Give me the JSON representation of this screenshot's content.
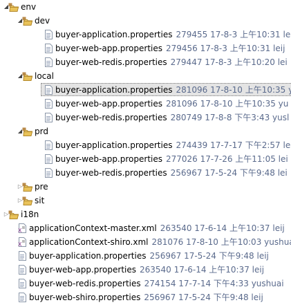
{
  "tree": {
    "rows": [
      {
        "kind": "folder",
        "expanded": true,
        "depth": 0,
        "name": "env",
        "meta": ""
      },
      {
        "kind": "folder",
        "expanded": true,
        "depth": 1,
        "name": "dev",
        "meta": ""
      },
      {
        "kind": "file",
        "depth": 2,
        "name": "buyer-application.properties",
        "meta": "279455  17-8-3 上午10:31  le"
      },
      {
        "kind": "file",
        "depth": 2,
        "name": "buyer-web-app.properties",
        "meta": "279456  17-8-3 上午10:31  leij"
      },
      {
        "kind": "file",
        "depth": 2,
        "name": "buyer-web-redis.properties",
        "meta": "279447  17-8-3 上午10:20  lei"
      },
      {
        "kind": "folder",
        "expanded": true,
        "depth": 1,
        "name": "local",
        "meta": ""
      },
      {
        "kind": "file",
        "depth": 2,
        "name": "buyer-application.properties",
        "meta": "281096  17-8-10 上午10:35  yu",
        "selected": true
      },
      {
        "kind": "file",
        "depth": 2,
        "name": "buyer-web-app.properties",
        "meta": "281096  17-8-10 上午10:35  yu"
      },
      {
        "kind": "file",
        "depth": 2,
        "name": "buyer-web-redis.properties",
        "meta": "280749  17-8-8 下午3:43  yusl"
      },
      {
        "kind": "folder",
        "expanded": true,
        "depth": 1,
        "name": "prd",
        "meta": ""
      },
      {
        "kind": "file",
        "depth": 2,
        "name": "buyer-application.properties",
        "meta": "274439  17-7-17 下午2:57  le"
      },
      {
        "kind": "file",
        "depth": 2,
        "name": "buyer-web-app.properties",
        "meta": "277026  17-7-26 上午11:05  lei"
      },
      {
        "kind": "file",
        "depth": 2,
        "name": "buyer-web-redis.properties",
        "meta": "256967  17-5-24 下午9:48  lei"
      },
      {
        "kind": "folder",
        "expanded": false,
        "depth": 1,
        "name": "pre",
        "meta": ""
      },
      {
        "kind": "folder",
        "expanded": false,
        "depth": 1,
        "name": "sit",
        "meta": ""
      },
      {
        "kind": "folder",
        "expanded": false,
        "depth": 0,
        "name": "i18n",
        "meta": ""
      },
      {
        "kind": "xml",
        "depth": 0,
        "name": "applicationContext-master.xml",
        "meta": "263540  17-6-14 上午10:37  leij"
      },
      {
        "kind": "xml",
        "depth": 0,
        "name": "applicationContext-shiro.xml",
        "meta": "281076  17-8-10 上午10:03  yushua"
      },
      {
        "kind": "file",
        "depth": 0,
        "name": "buyer-application.properties",
        "meta": "256967  17-5-24 下午9:48  leij"
      },
      {
        "kind": "file",
        "depth": 0,
        "name": "buyer-web-app.properties",
        "meta": "263540  17-6-14 上午10:37  leij"
      },
      {
        "kind": "file",
        "depth": 0,
        "name": "buyer-web-redis.properties",
        "meta": "274154  17-7-14 下午4:33  yushuai"
      },
      {
        "kind": "file",
        "depth": 0,
        "name": "buyer-web-shiro.properties",
        "meta": "256967  17-5-24 下午9:48  leij"
      }
    ]
  }
}
